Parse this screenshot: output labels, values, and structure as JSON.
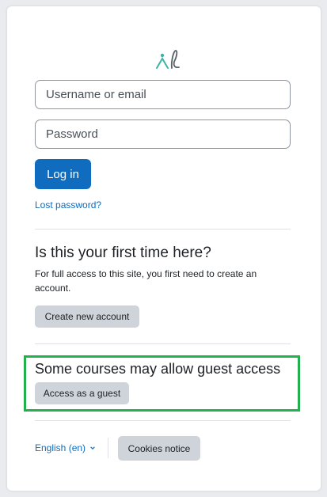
{
  "login": {
    "username_placeholder": "Username or email",
    "password_placeholder": "Password",
    "login_label": "Log in",
    "lost_password": "Lost password?"
  },
  "signup": {
    "heading": "Is this your first time here?",
    "description": "For full access to this site, you first need to create an account.",
    "create_label": "Create new account"
  },
  "guest": {
    "heading": "Some courses may allow guest access",
    "button_label": "Access as a guest"
  },
  "footer": {
    "language": "English (en)",
    "language_icon": "chevron-down-icon",
    "cookies_label": "Cookies notice"
  },
  "colors": {
    "primary": "#0f6cbf",
    "secondary_button": "#ced4da",
    "highlight_border": "#22b14c"
  }
}
